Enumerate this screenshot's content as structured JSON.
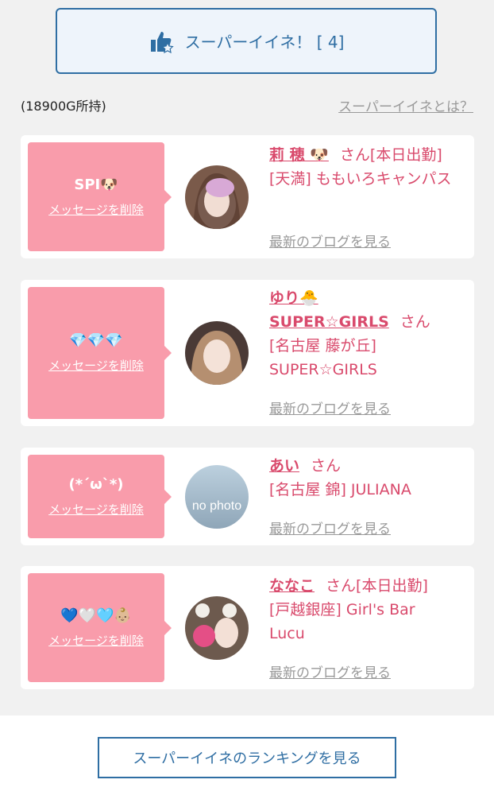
{
  "super_like": {
    "label": "スーパーイイネ！ [ 4]"
  },
  "balance": "(18900G所持)",
  "about_link": "スーパーイイネとは？",
  "delete_label": "メッセージを削除",
  "blog_label": "最新のブログを見る",
  "san": "さん",
  "cards": [
    {
      "message": "SPI🐶",
      "name": "莉 穂 🐶",
      "status": "[本日出勤]",
      "shop": "[天満] ももいろキャンパス"
    },
    {
      "message": "💎💎💎",
      "name": "ゆり🐣",
      "name2": "SUPER☆GIRLS",
      "status": "",
      "shop": "[名古屋 藤が丘] SUPER☆GIRLS"
    },
    {
      "message": "(*´ω`*)",
      "name": "あい",
      "status": "",
      "shop": "[名古屋 錦] JULIANA",
      "avatar_text": "no photo"
    },
    {
      "message": "💙🤍🩵👶🏼",
      "name": "ななこ",
      "status": "[本日出勤]",
      "shop": "[戸越銀座] Girl's Bar Lucu"
    }
  ],
  "ranking_button": "スーパーイイネのランキングを見る"
}
